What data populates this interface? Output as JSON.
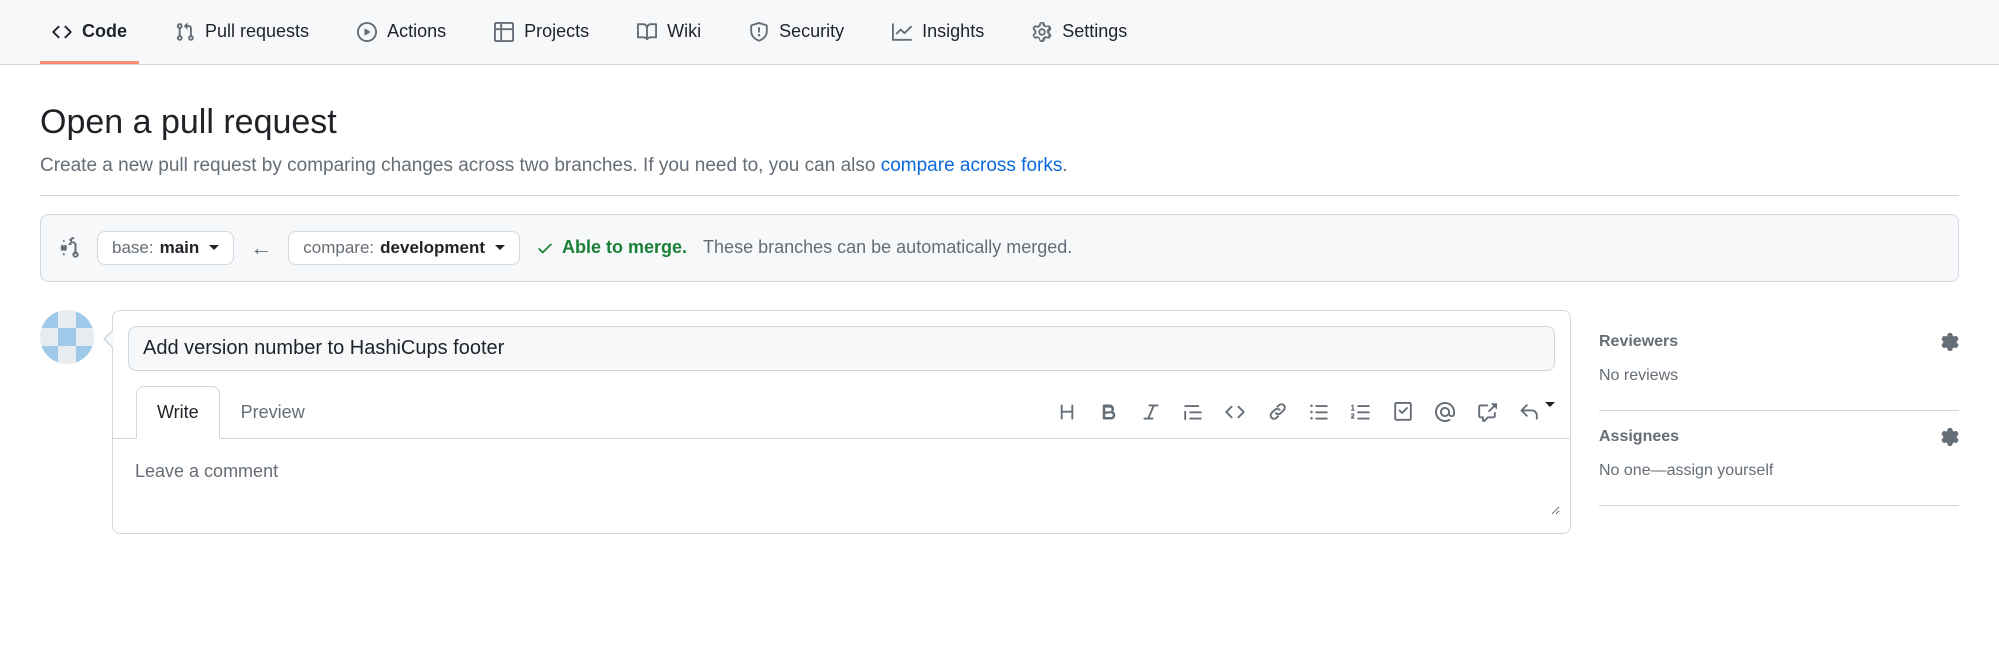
{
  "nav": {
    "code": "Code",
    "pulls": "Pull requests",
    "actions": "Actions",
    "projects": "Projects",
    "wiki": "Wiki",
    "security": "Security",
    "insights": "Insights",
    "settings": "Settings"
  },
  "page": {
    "title": "Open a pull request",
    "subtitle_prefix": "Create a new pull request by comparing changes across two branches. If you need to, you can also ",
    "subtitle_link": "compare across forks",
    "subtitle_suffix": "."
  },
  "compare": {
    "base_label": "base:",
    "base_branch": "main",
    "compare_label": "compare:",
    "compare_branch": "development",
    "merge_status": "Able to merge.",
    "merge_desc": "These branches can be automatically merged."
  },
  "form": {
    "title_value": "Add version number to HashiCups footer",
    "tab_write": "Write",
    "tab_preview": "Preview",
    "comment_placeholder": "Leave a comment"
  },
  "sidebar": {
    "reviewers_title": "Reviewers",
    "reviewers_body": "No reviews",
    "assignees_title": "Assignees",
    "assignees_body": "No one—",
    "assign_self": "assign yourself"
  }
}
